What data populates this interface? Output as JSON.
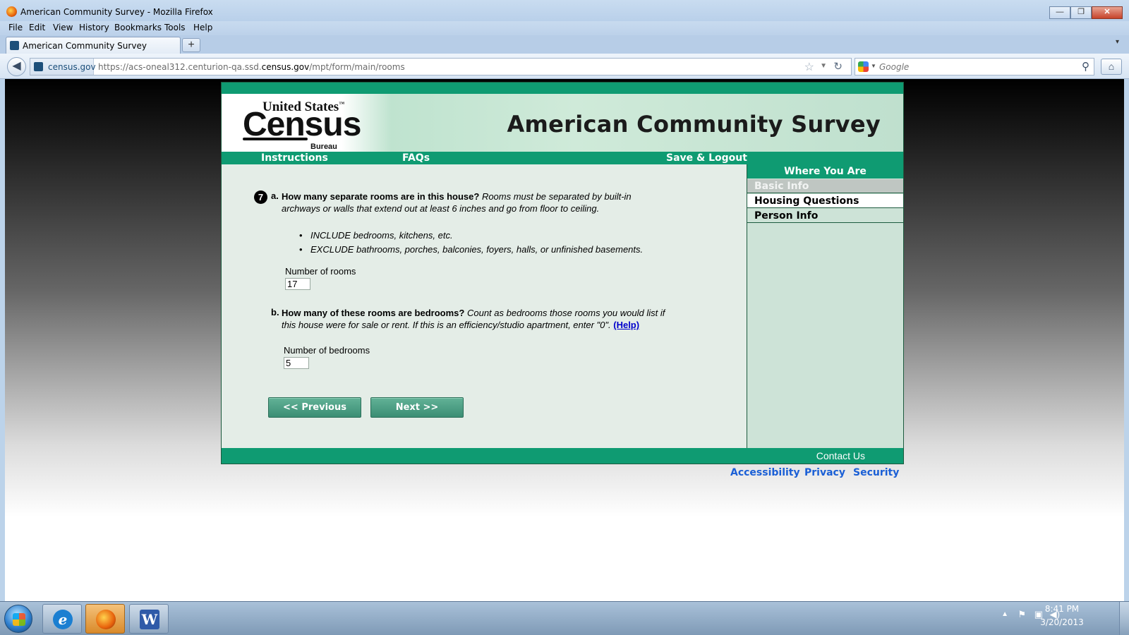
{
  "window": {
    "title": "American Community Survey - Mozilla Firefox",
    "minimize": "—",
    "maximize": "❐",
    "close": "✕"
  },
  "menu": [
    "File",
    "Edit",
    "View",
    "History",
    "Bookmarks",
    "Tools",
    "Help"
  ],
  "tab": {
    "label": "American Community Survey",
    "new_tab": "+"
  },
  "address": {
    "site": "census.gov",
    "url_prefix": "https://acs-oneal312.centurion-qa.ssd.",
    "url_domain": "census.gov",
    "url_path": "/mpt/form/main/rooms"
  },
  "search": {
    "placeholder": "Google"
  },
  "census": {
    "logo_line1": "United States",
    "logo_tm": "™",
    "logo_line2": "Census",
    "logo_line3": "Bureau",
    "survey_title": "American Community Survey",
    "nav": {
      "instructions": "Instructions",
      "faqs": "FAQs",
      "save_logout": "Save & Logout"
    },
    "question": {
      "number": "7",
      "a": {
        "letter": "a.",
        "bold": "How many separate rooms are in this house?",
        "italic_line1": "Rooms must be separated by built-in",
        "italic_line2": "archways or walls that extend out at least 6 inches and go from floor to ceiling.",
        "bullets": [
          "INCLUDE bedrooms, kitchens, etc.",
          "EXCLUDE bathrooms, porches, balconies, foyers, halls, or unfinished basements."
        ],
        "field_label": "Number of rooms",
        "value": "17"
      },
      "b": {
        "letter": "b.",
        "bold": "How many of these rooms are bedrooms?",
        "italic_line1": "Count as bedrooms those rooms you would list if",
        "italic_line2": "this house were for sale or rent. If this is an efficiency/studio apartment, enter \"0\".",
        "help": "(Help)",
        "field_label": "Number of bedrooms",
        "value": "5"
      }
    },
    "buttons": {
      "previous": "<<   Previous",
      "next": "Next   >>"
    },
    "sidebar": {
      "title": "Where You Are",
      "items": [
        {
          "label": "Basic Info",
          "state": "done"
        },
        {
          "label": "Housing Questions",
          "state": "current"
        },
        {
          "label": "Person Info",
          "state": "pending"
        }
      ]
    },
    "footer": {
      "contact": "Contact Us",
      "links": [
        "Accessibility",
        "Privacy",
        "Security"
      ]
    }
  },
  "taskbar": {
    "apps": [
      "Internet Explorer",
      "Firefox",
      "Word"
    ],
    "ie_glyph": "e",
    "word_glyph": "W",
    "time": "8:41 PM",
    "date": "3/20/2013"
  }
}
